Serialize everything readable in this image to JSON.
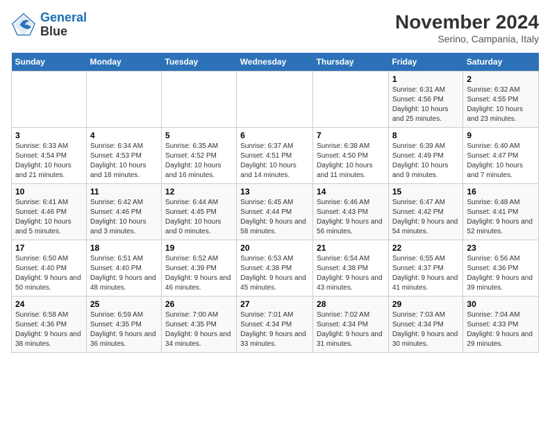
{
  "header": {
    "logo_line1": "General",
    "logo_line2": "Blue",
    "title": "November 2024",
    "subtitle": "Serino, Campania, Italy"
  },
  "weekdays": [
    "Sunday",
    "Monday",
    "Tuesday",
    "Wednesday",
    "Thursday",
    "Friday",
    "Saturday"
  ],
  "weeks": [
    [
      {
        "day": "",
        "info": ""
      },
      {
        "day": "",
        "info": ""
      },
      {
        "day": "",
        "info": ""
      },
      {
        "day": "",
        "info": ""
      },
      {
        "day": "",
        "info": ""
      },
      {
        "day": "1",
        "info": "Sunrise: 6:31 AM\nSunset: 4:56 PM\nDaylight: 10 hours and 25 minutes."
      },
      {
        "day": "2",
        "info": "Sunrise: 6:32 AM\nSunset: 4:55 PM\nDaylight: 10 hours and 23 minutes."
      }
    ],
    [
      {
        "day": "3",
        "info": "Sunrise: 6:33 AM\nSunset: 4:54 PM\nDaylight: 10 hours and 21 minutes."
      },
      {
        "day": "4",
        "info": "Sunrise: 6:34 AM\nSunset: 4:53 PM\nDaylight: 10 hours and 18 minutes."
      },
      {
        "day": "5",
        "info": "Sunrise: 6:35 AM\nSunset: 4:52 PM\nDaylight: 10 hours and 16 minutes."
      },
      {
        "day": "6",
        "info": "Sunrise: 6:37 AM\nSunset: 4:51 PM\nDaylight: 10 hours and 14 minutes."
      },
      {
        "day": "7",
        "info": "Sunrise: 6:38 AM\nSunset: 4:50 PM\nDaylight: 10 hours and 11 minutes."
      },
      {
        "day": "8",
        "info": "Sunrise: 6:39 AM\nSunset: 4:49 PM\nDaylight: 10 hours and 9 minutes."
      },
      {
        "day": "9",
        "info": "Sunrise: 6:40 AM\nSunset: 4:47 PM\nDaylight: 10 hours and 7 minutes."
      }
    ],
    [
      {
        "day": "10",
        "info": "Sunrise: 6:41 AM\nSunset: 4:46 PM\nDaylight: 10 hours and 5 minutes."
      },
      {
        "day": "11",
        "info": "Sunrise: 6:42 AM\nSunset: 4:46 PM\nDaylight: 10 hours and 3 minutes."
      },
      {
        "day": "12",
        "info": "Sunrise: 6:44 AM\nSunset: 4:45 PM\nDaylight: 10 hours and 0 minutes."
      },
      {
        "day": "13",
        "info": "Sunrise: 6:45 AM\nSunset: 4:44 PM\nDaylight: 9 hours and 58 minutes."
      },
      {
        "day": "14",
        "info": "Sunrise: 6:46 AM\nSunset: 4:43 PM\nDaylight: 9 hours and 56 minutes."
      },
      {
        "day": "15",
        "info": "Sunrise: 6:47 AM\nSunset: 4:42 PM\nDaylight: 9 hours and 54 minutes."
      },
      {
        "day": "16",
        "info": "Sunrise: 6:48 AM\nSunset: 4:41 PM\nDaylight: 9 hours and 52 minutes."
      }
    ],
    [
      {
        "day": "17",
        "info": "Sunrise: 6:50 AM\nSunset: 4:40 PM\nDaylight: 9 hours and 50 minutes."
      },
      {
        "day": "18",
        "info": "Sunrise: 6:51 AM\nSunset: 4:40 PM\nDaylight: 9 hours and 48 minutes."
      },
      {
        "day": "19",
        "info": "Sunrise: 6:52 AM\nSunset: 4:39 PM\nDaylight: 9 hours and 46 minutes."
      },
      {
        "day": "20",
        "info": "Sunrise: 6:53 AM\nSunset: 4:38 PM\nDaylight: 9 hours and 45 minutes."
      },
      {
        "day": "21",
        "info": "Sunrise: 6:54 AM\nSunset: 4:38 PM\nDaylight: 9 hours and 43 minutes."
      },
      {
        "day": "22",
        "info": "Sunrise: 6:55 AM\nSunset: 4:37 PM\nDaylight: 9 hours and 41 minutes."
      },
      {
        "day": "23",
        "info": "Sunrise: 6:56 AM\nSunset: 4:36 PM\nDaylight: 9 hours and 39 minutes."
      }
    ],
    [
      {
        "day": "24",
        "info": "Sunrise: 6:58 AM\nSunset: 4:36 PM\nDaylight: 9 hours and 38 minutes."
      },
      {
        "day": "25",
        "info": "Sunrise: 6:59 AM\nSunset: 4:35 PM\nDaylight: 9 hours and 36 minutes."
      },
      {
        "day": "26",
        "info": "Sunrise: 7:00 AM\nSunset: 4:35 PM\nDaylight: 9 hours and 34 minutes."
      },
      {
        "day": "27",
        "info": "Sunrise: 7:01 AM\nSunset: 4:34 PM\nDaylight: 9 hours and 33 minutes."
      },
      {
        "day": "28",
        "info": "Sunrise: 7:02 AM\nSunset: 4:34 PM\nDaylight: 9 hours and 31 minutes."
      },
      {
        "day": "29",
        "info": "Sunrise: 7:03 AM\nSunset: 4:34 PM\nDaylight: 9 hours and 30 minutes."
      },
      {
        "day": "30",
        "info": "Sunrise: 7:04 AM\nSunset: 4:33 PM\nDaylight: 9 hours and 29 minutes."
      }
    ]
  ]
}
